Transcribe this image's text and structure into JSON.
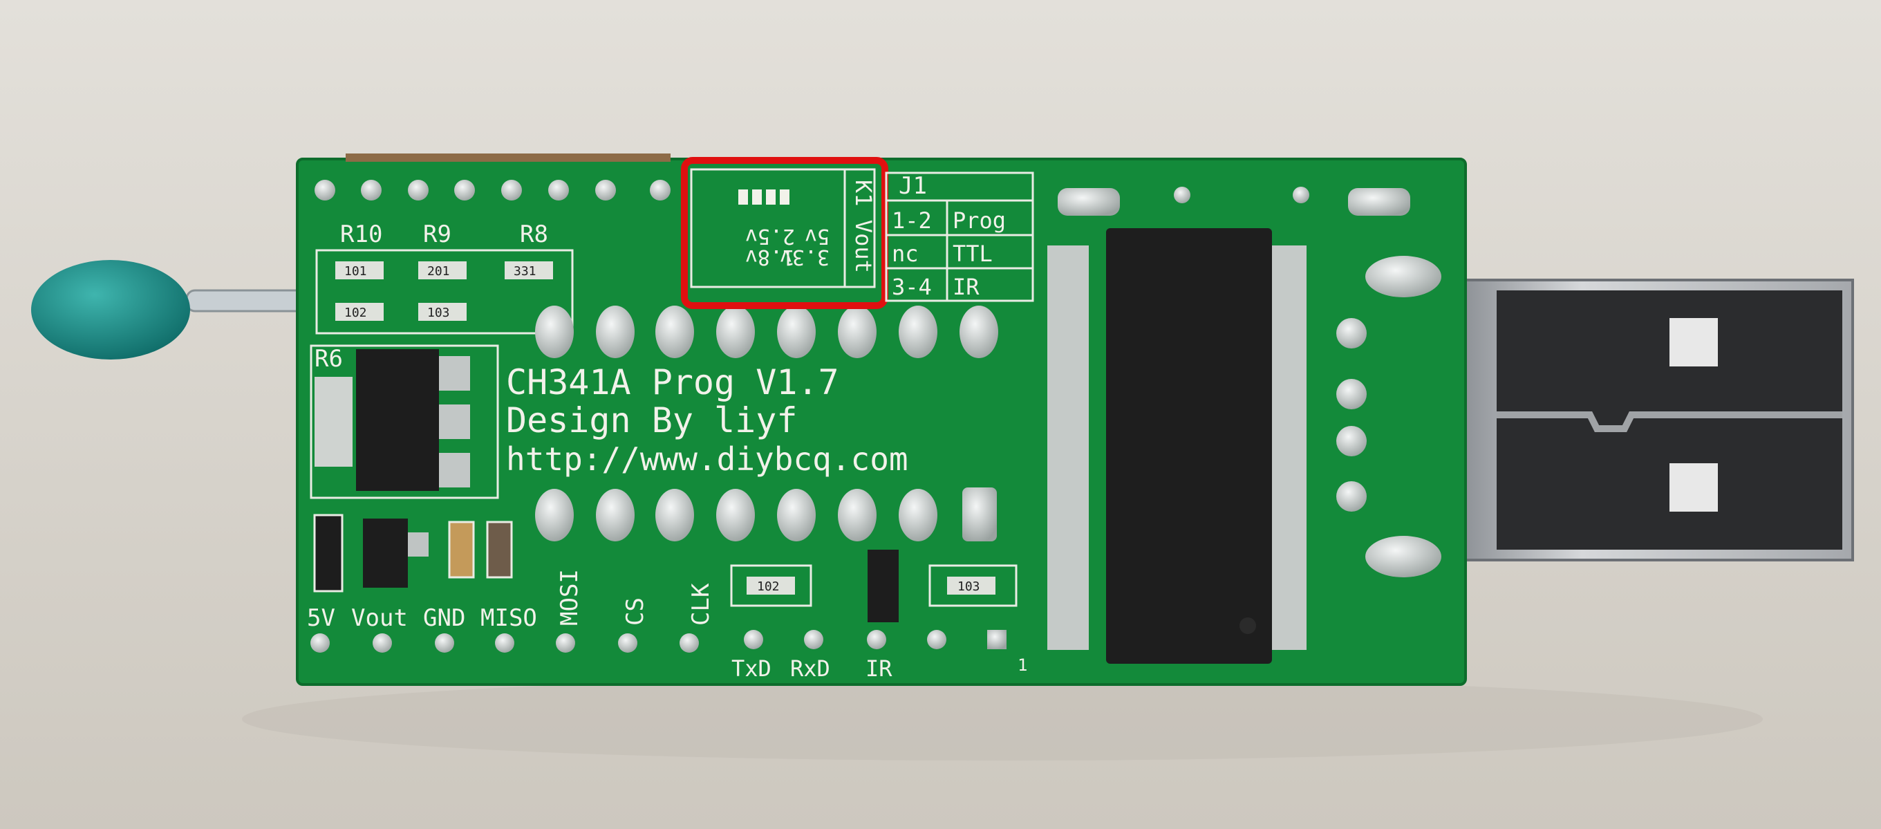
{
  "board": {
    "title": "CH341A Prog V1.7",
    "designer": "Design By liyf",
    "url": "http://www.diybcq.com"
  },
  "resistor_labels": [
    "R10",
    "R9",
    "R8",
    "R6"
  ],
  "resistor_codes": [
    "101",
    "201",
    "331",
    "102",
    "103"
  ],
  "lower_resistor_codes": [
    "102",
    "103"
  ],
  "k1_table": {
    "header": "K1 Vout",
    "options": [
      "5v",
      "3.3v",
      "2.5v",
      "1.8v"
    ]
  },
  "j1_table": {
    "header": "J1",
    "rows": [
      {
        "jumper": "1-2",
        "mode": "Prog"
      },
      {
        "jumper": "nc",
        "mode": "TTL"
      },
      {
        "jumper": "3-4",
        "mode": "IR"
      }
    ]
  },
  "pin_labels": [
    "5V",
    "Vout",
    "GND",
    "MISO",
    "MOSI",
    "CS",
    "CLK"
  ],
  "serial_labels": [
    "TxD",
    "RxD",
    "IR"
  ],
  "pin_one_marker": "1",
  "highlight": {
    "color": "#e01010"
  },
  "colors": {
    "pcb": "#138a3a",
    "background": "#d6d1c9",
    "usb_metal": "#b9bcc0",
    "chip": "#1e1e1e",
    "probe_head": "#1d8f8a"
  }
}
